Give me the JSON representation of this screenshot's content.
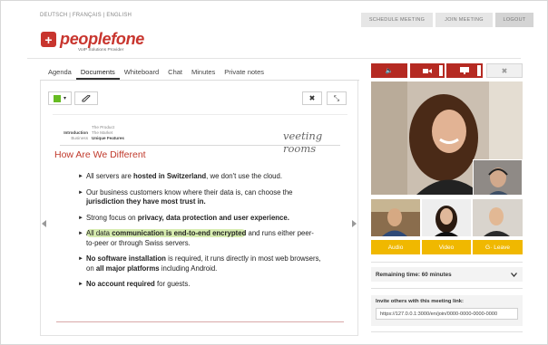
{
  "header": {
    "languages": "DEUTSCH | FRANÇAIS | ENGLISH",
    "buttons": {
      "schedule": "SCHEDULE MEETING",
      "join": "JOIN MEETING",
      "logout": "LOGOUT"
    },
    "logo_mark": "+",
    "brand": "peoplefone",
    "tagline": "VoIP Solutions Provider"
  },
  "tabs": [
    "Agenda",
    "Documents",
    "Whiteboard",
    "Chat",
    "Minutes",
    "Private notes"
  ],
  "active_tab": "Documents",
  "doc_toolbar": {
    "color_swatch": "#66bb22",
    "caret": "▾",
    "pen_icon": "pen-icon",
    "close_icon": "✖",
    "expand_icon": "⤡"
  },
  "slide": {
    "nav": {
      "k1": "",
      "v1": "The Product",
      "k2": "Introduction",
      "v2": "The Market",
      "k3": "Business",
      "v3": "Unique Features"
    },
    "brand": "veeting rooms",
    "title": "How Are We Different",
    "bullets": [
      {
        "a": "All servers are ",
        "b": "hosted in Switzerland",
        "c": ", we don't use the cloud."
      },
      {
        "a": "Our business customers know where their data is, can choose the ",
        "b": "jurisdiction they have most trust in.",
        "c": ""
      },
      {
        "a": "Strong focus on ",
        "b": "privacy, data protection and user experience.",
        "c": ""
      },
      {
        "a": "All data ",
        "b": "communication is end-to-end encrypted",
        "c": " and runs either peer-to-peer or through Swiss servers."
      },
      {
        "a": "",
        "b": "No software installation",
        "c": " is required, it runs directly in most web browsers, on ",
        "d": "all major platforms",
        "e": " including Android."
      },
      {
        "a": "",
        "b": "No account required",
        "c": " for guests."
      }
    ]
  },
  "media": {
    "audio_icon": "🔈",
    "video_icon": "video-icon",
    "screen_icon": "screen-icon",
    "close": "✖"
  },
  "actions": {
    "audio": "Audio",
    "video": "Video",
    "leave": "Leave",
    "leave_icon": "G·"
  },
  "remaining": "Remaining time: 60 minutes",
  "invite": {
    "label": "Invite others with this meeting link:",
    "url": "https://127.0.0.1:3000/en/join/0000-0000-0000-0000"
  },
  "colors": {
    "brand_red": "#c8352e",
    "control_red": "#b52a22",
    "action_yellow": "#f0b800"
  }
}
